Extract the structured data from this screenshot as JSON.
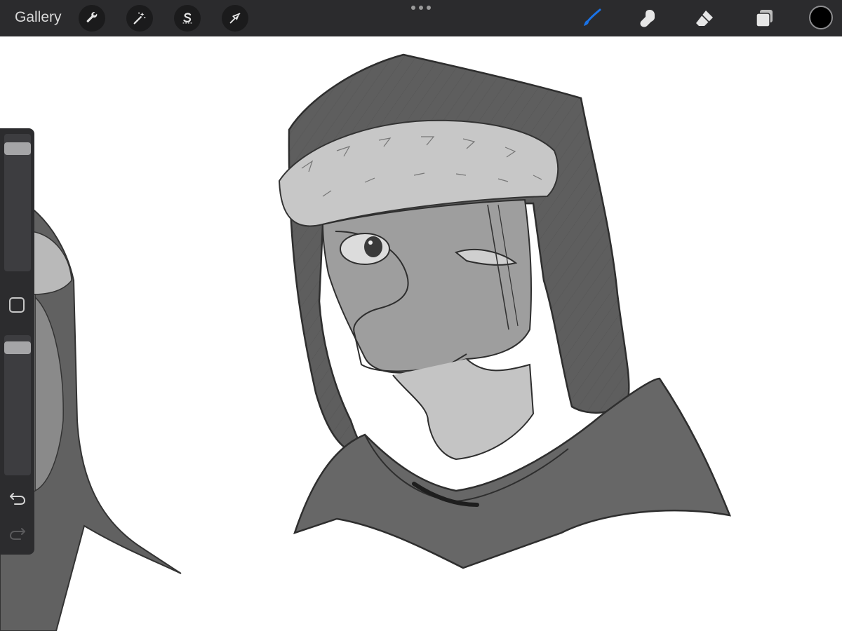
{
  "toolbar": {
    "gallery_label": "Gallery",
    "left_tools": [
      {
        "name": "actions",
        "icon": "wrench-icon"
      },
      {
        "name": "adjustments",
        "icon": "magic-wand-icon"
      },
      {
        "name": "selection",
        "icon": "selection-s-icon"
      },
      {
        "name": "transform",
        "icon": "arrow-cursor-icon"
      }
    ],
    "right_tools": [
      {
        "name": "brush",
        "icon": "brush-icon",
        "active": true
      },
      {
        "name": "smudge",
        "icon": "smudge-finger-icon",
        "active": false
      },
      {
        "name": "eraser",
        "icon": "eraser-icon",
        "active": false
      },
      {
        "name": "layers",
        "icon": "layers-icon",
        "active": false
      }
    ],
    "active_color": "#000000",
    "accent_color": "#1a73e8"
  },
  "sidebar": {
    "brush_size_level": 0.93,
    "opacity_level": 0.95,
    "modify_icon": "square-modify-icon",
    "undo_icon": "undo-arrow-icon",
    "redo_icon": "redo-arrow-icon"
  }
}
